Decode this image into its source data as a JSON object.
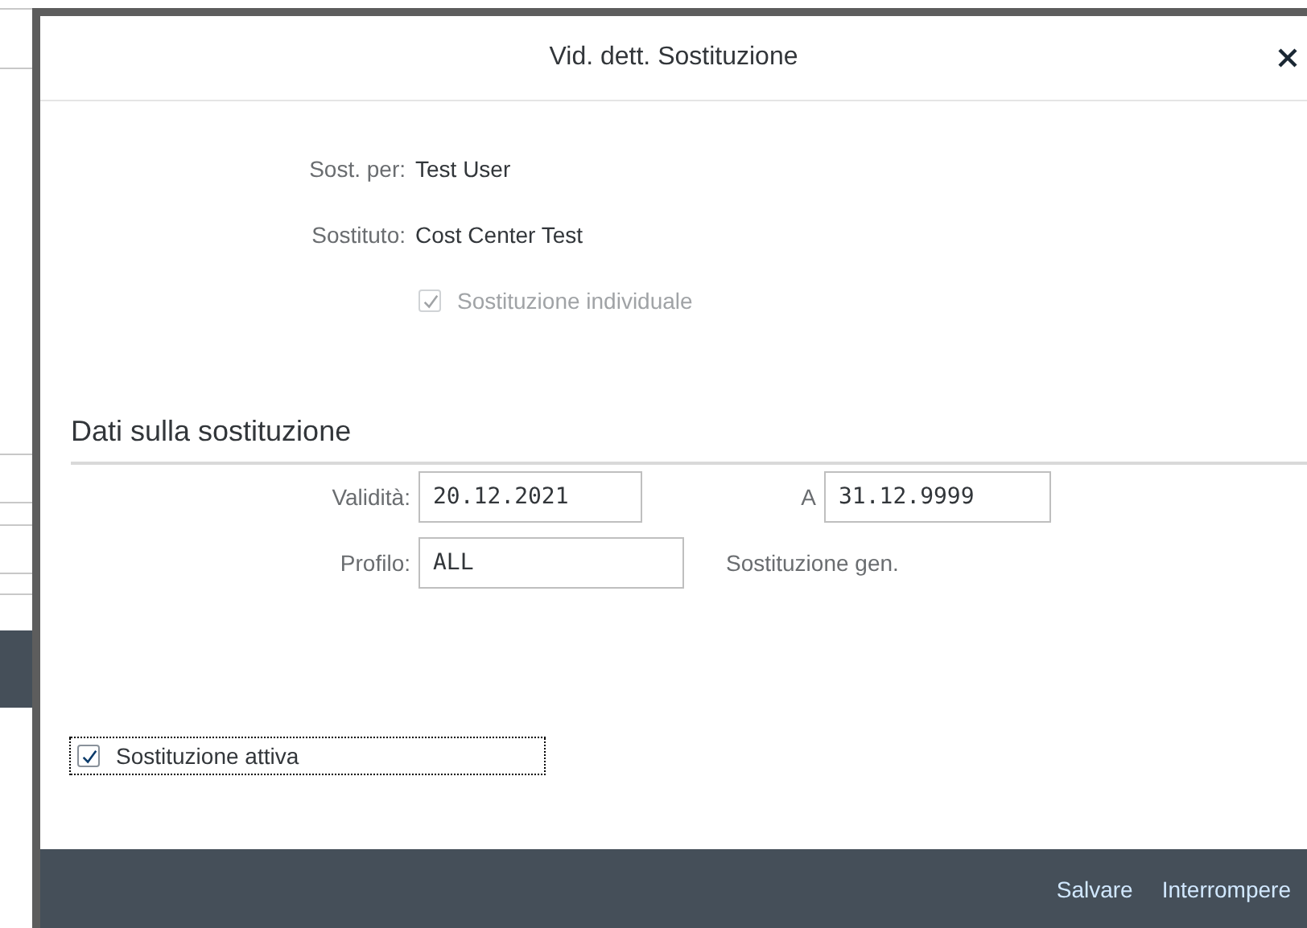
{
  "dialog": {
    "title": "Vid. dett. Sostituzione"
  },
  "info": [
    {
      "label": "Sost. per:",
      "value": "Test User"
    },
    {
      "label": "Sostituto:",
      "value": "Cost Center Test"
    }
  ],
  "individual_checkbox": {
    "label": "Sostituzione individuale",
    "checked": true,
    "disabled": true
  },
  "section": {
    "title": "Dati sulla sostituzione"
  },
  "validity": {
    "label": "Validità:",
    "value": "20.12.2021"
  },
  "validity_to": {
    "label": "A",
    "value": "31.12.9999"
  },
  "profile": {
    "label": "Profilo:",
    "value": "ALL",
    "description": "Sostituzione gen."
  },
  "active_checkbox": {
    "label": "Sostituzione attiva",
    "checked": true,
    "disabled": false,
    "focused": true
  },
  "footer_buttons": [
    {
      "label": "Salvare"
    },
    {
      "label": "Interrompere"
    }
  ]
}
